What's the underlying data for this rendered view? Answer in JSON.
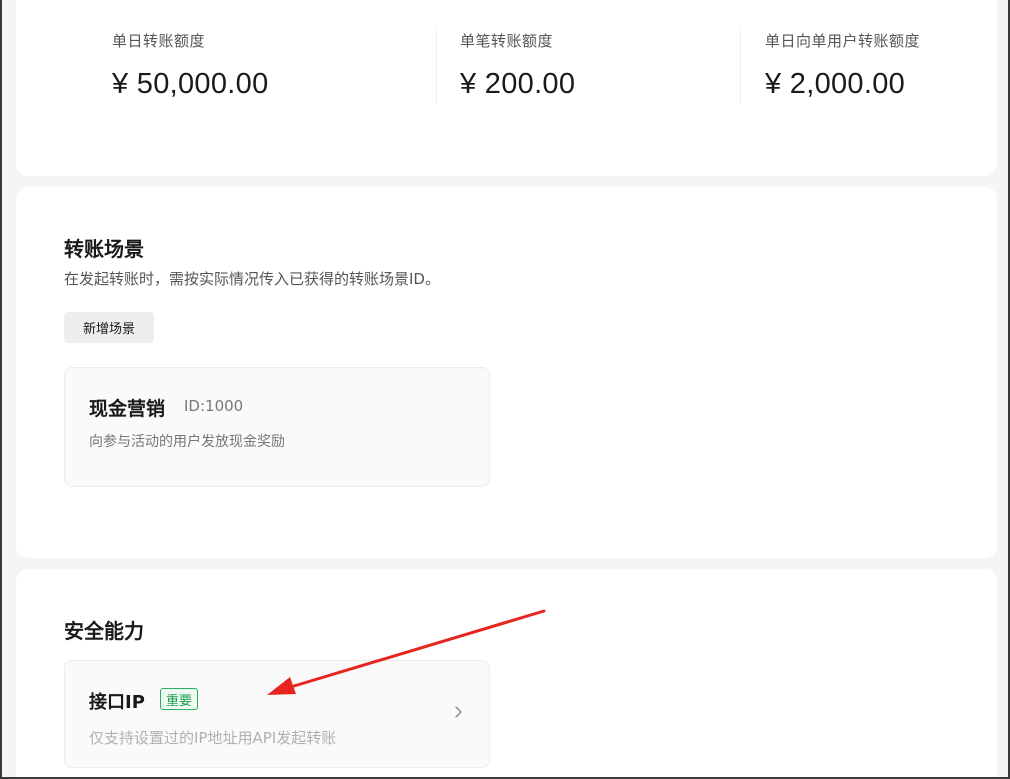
{
  "limits": [
    {
      "label": "单日转账额度",
      "value": "¥ 50,000.00"
    },
    {
      "label": "单笔转账额度",
      "value": "¥ 200.00"
    },
    {
      "label": "单日向单用户转账额度",
      "value": "¥ 2,000.00"
    }
  ],
  "scenes": {
    "title": "转账场景",
    "description": "在发起转账时，需按实际情况传入已获得的转账场景ID。",
    "add_button": "新增场景",
    "items": [
      {
        "name": "现金营销",
        "id_text": "ID:1000",
        "description": "向参与活动的用户发放现金奖励"
      }
    ]
  },
  "security": {
    "title": "安全能力",
    "items": [
      {
        "name": "接口IP",
        "badge": "重要",
        "description": "仅支持设置过的IP地址用API发起转账",
        "icon": "chevron-right-icon"
      }
    ]
  },
  "colors": {
    "badge_green": "#1e9e4f",
    "annotation_arrow": "#e8241f"
  }
}
